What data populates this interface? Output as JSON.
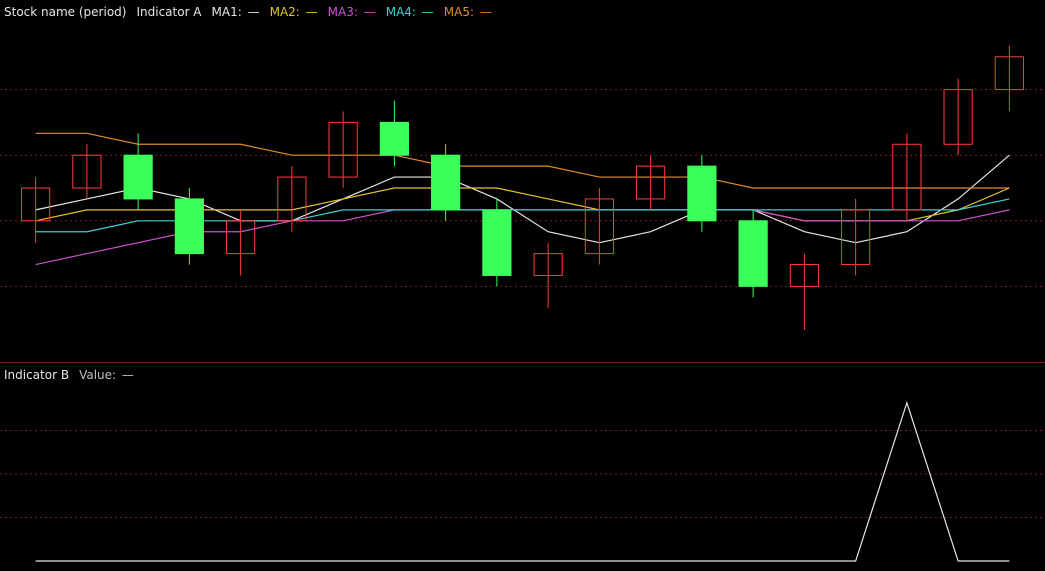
{
  "main_header": {
    "title": "Stock name (period)",
    "indicator_name": "Indicator A",
    "items": [
      {
        "label": "MA1",
        "value": "—",
        "color": "#e6e6e6"
      },
      {
        "label": "MA2",
        "value": "—",
        "color": "#e6c229"
      },
      {
        "label": "MA3",
        "value": "—",
        "color": "#d04fd0"
      },
      {
        "label": "MA4",
        "value": "—",
        "color": "#3fd0d0"
      },
      {
        "label": "MA5",
        "value": "—",
        "color": "#e08a2c"
      }
    ]
  },
  "sub_header": {
    "indicator_name": "Indicator B",
    "value_label": "Value",
    "value": "—"
  },
  "colors": {
    "up": "#ff3b3b",
    "down": "#3bff5a",
    "grid": "#7a1f1f",
    "background": "#000000"
  },
  "chart_data": [
    {
      "type": "candlestick",
      "title": "",
      "candles": [
        {
          "o": 100,
          "h": 104,
          "l": 98,
          "c": 103
        },
        {
          "o": 103,
          "h": 107,
          "l": 102,
          "c": 106
        },
        {
          "o": 106,
          "h": 108,
          "l": 101,
          "c": 102
        },
        {
          "o": 102,
          "h": 103,
          "l": 96,
          "c": 97
        },
        {
          "o": 97,
          "h": 101,
          "l": 95,
          "c": 100
        },
        {
          "o": 100,
          "h": 105,
          "l": 99,
          "c": 104
        },
        {
          "o": 104,
          "h": 110,
          "l": 103,
          "c": 109
        },
        {
          "o": 109,
          "h": 111,
          "l": 105,
          "c": 106
        },
        {
          "o": 106,
          "h": 107,
          "l": 100,
          "c": 101
        },
        {
          "o": 101,
          "h": 102,
          "l": 94,
          "c": 95
        },
        {
          "o": 95,
          "h": 98,
          "l": 92,
          "c": 97
        },
        {
          "o": 97,
          "h": 103,
          "l": 96,
          "c": 102
        },
        {
          "o": 102,
          "h": 106,
          "l": 101,
          "c": 105
        },
        {
          "o": 105,
          "h": 106,
          "l": 99,
          "c": 100
        },
        {
          "o": 100,
          "h": 101,
          "l": 93,
          "c": 94
        },
        {
          "o": 94,
          "h": 97,
          "l": 90,
          "c": 96
        },
        {
          "o": 96,
          "h": 102,
          "l": 95,
          "c": 101
        },
        {
          "o": 101,
          "h": 108,
          "l": 100,
          "c": 107
        },
        {
          "o": 107,
          "h": 113,
          "l": 106,
          "c": 112
        },
        {
          "o": 112,
          "h": 116,
          "l": 110,
          "c": 115
        }
      ],
      "lines": [
        {
          "name": "MA1",
          "color": "#e6e6e6",
          "values": [
            101,
            102,
            103,
            102,
            100,
            100,
            102,
            104,
            104,
            102,
            99,
            98,
            99,
            101,
            101,
            99,
            98,
            99,
            102,
            106
          ]
        },
        {
          "name": "MA2",
          "color": "#e6c229",
          "values": [
            100,
            101,
            101,
            101,
            101,
            101,
            102,
            103,
            103,
            103,
            102,
            101,
            101,
            101,
            101,
            100,
            100,
            100,
            101,
            103
          ]
        },
        {
          "name": "MA3",
          "color": "#d04fd0",
          "values": [
            96,
            97,
            98,
            99,
            99,
            100,
            100,
            101,
            101,
            101,
            101,
            101,
            101,
            101,
            101,
            100,
            100,
            100,
            100,
            101
          ]
        },
        {
          "name": "MA4",
          "color": "#3fd0d0",
          "values": [
            99,
            99,
            100,
            100,
            100,
            100,
            101,
            101,
            101,
            101,
            101,
            101,
            101,
            101,
            101,
            101,
            101,
            101,
            101,
            102
          ]
        },
        {
          "name": "MA5",
          "color": "#e08a2c",
          "values": [
            108,
            108,
            107,
            107,
            107,
            106,
            106,
            106,
            105,
            105,
            105,
            104,
            104,
            104,
            103,
            103,
            103,
            103,
            103,
            103
          ]
        }
      ],
      "ylim": [
        88,
        118
      ]
    },
    {
      "type": "line",
      "title": "",
      "values": [
        0,
        0,
        0,
        0,
        0,
        0,
        0,
        0,
        0,
        0,
        0,
        0,
        0,
        0,
        0,
        0,
        0,
        1,
        0,
        0
      ],
      "ylim": [
        0,
        1.1
      ]
    }
  ]
}
